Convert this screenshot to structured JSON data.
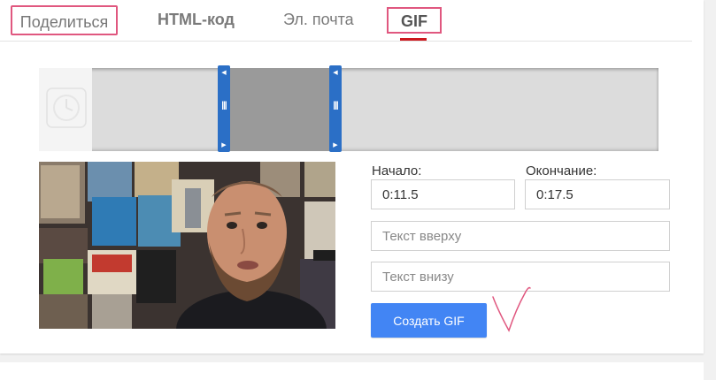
{
  "tabs": [
    {
      "label": "Поделиться"
    },
    {
      "label": "HTML-код"
    },
    {
      "label": "Эл. почта"
    },
    {
      "label": "GIF"
    }
  ],
  "gif_form": {
    "start_label": "Начало:",
    "end_label": "Окончание:",
    "start_value": "0:11.5",
    "end_value": "0:17.5",
    "top_text_placeholder": "Текст вверху",
    "bottom_text_placeholder": "Текст внизу",
    "create_button": "Создать GIF"
  },
  "colors": {
    "accent": "#4285f4",
    "handle": "#2b6fc6",
    "highlight": "#e0577f",
    "active_tab_underline": "#cc181e"
  },
  "icons": {
    "timeline_thumb": "clock-icon",
    "handle_arrow_left": "chevron-left-icon",
    "handle_arrow_right": "chevron-right-icon",
    "handle_grip": "grip-icon"
  }
}
